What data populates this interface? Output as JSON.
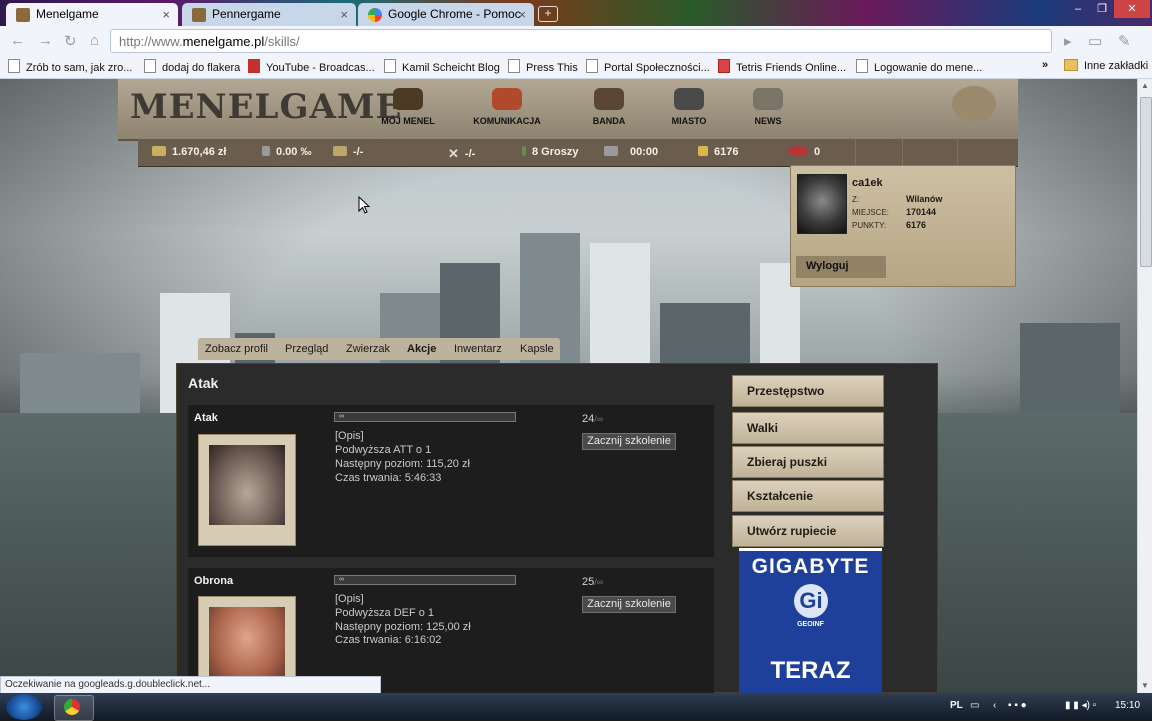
{
  "browser": {
    "tabs": [
      {
        "title": "Menelgame",
        "active": true
      },
      {
        "title": "Pennergame",
        "active": false
      },
      {
        "title": "Google Chrome - Pomoc",
        "active": false
      }
    ],
    "url": {
      "scheme": "http://www.",
      "host": "menelgame.pl",
      "path": "/skills/"
    },
    "bookmarks": [
      "Zrób to sam, jak zro...",
      "dodaj do flakera",
      "YouTube - Broadcas...",
      "Kamil Scheicht Blog",
      "Press This",
      "Portal Społeczności...",
      "Tetris Friends Online...",
      "Logowanie do mene..."
    ],
    "other_bookmarks": "Inne zakładki",
    "chevron": "»",
    "status_text": "Oczekiwanie na googleads.g.doubleclick.net..."
  },
  "game": {
    "logo": "MENELGAME",
    "nav": [
      {
        "label": "MÓJ MENEL",
        "icon": "shoe-icon"
      },
      {
        "label": "KOMUNIKACJA",
        "icon": "arrows-icon"
      },
      {
        "label": "BANDA",
        "icon": "group-icon"
      },
      {
        "label": "MIASTO",
        "icon": "city-icon"
      },
      {
        "label": "NEWS",
        "icon": "newspaper-icon"
      }
    ],
    "stats": {
      "money": "1.670,46 zł",
      "percent": "0.00 ‰",
      "item1": "-/-",
      "item2": "-/-",
      "groszy": "8 Groszy",
      "time": "00:00",
      "points": "6176",
      "coins": "0"
    },
    "profile": {
      "name": "ca1ek",
      "labels": {
        "from": "Z:",
        "place": "MIEJSCE:",
        "points": "PUNKTY:"
      },
      "from": "Wilanów",
      "place": "170144",
      "points": "6176",
      "logout": "Wyloguj"
    },
    "subnav": [
      "Zobacz profil",
      "Przegląd",
      "Zwierzak",
      "Akcje",
      "Inwentarz",
      "Kapsle"
    ],
    "panel_title": "Atak",
    "skills": [
      {
        "name": "Atak",
        "progress_label": "∞",
        "desc_link": "[Opis]",
        "effect": "Podwyższa ATT o 1",
        "next_level": "Następny poziom: 115,20 zł",
        "duration": "Czas trwania: 5:46:33",
        "level": "24",
        "level_max": "/∞",
        "button": "Zacznij szkolenie"
      },
      {
        "name": "Obrona",
        "progress_label": "∞",
        "desc_link": "[Opis]",
        "effect": "Podwyższa DEF o 1",
        "next_level": "Następny poziom: 125,00 zł",
        "duration": "Czas trwania: 6:16:02",
        "level": "25",
        "level_max": "/∞",
        "button": "Zacznij szkolenie"
      }
    ],
    "right_menu": [
      "Przestępstwo",
      "Walki",
      "Zbieraj puszki",
      "Kształcenie",
      "Utwórz rupiecie"
    ],
    "ad": {
      "brand": "GIGABYTE",
      "mark": "Gi",
      "small": "GEOINF",
      "cta": "TERAZ"
    }
  },
  "taskbar": {
    "lang": "PL",
    "clock": "15:10"
  }
}
